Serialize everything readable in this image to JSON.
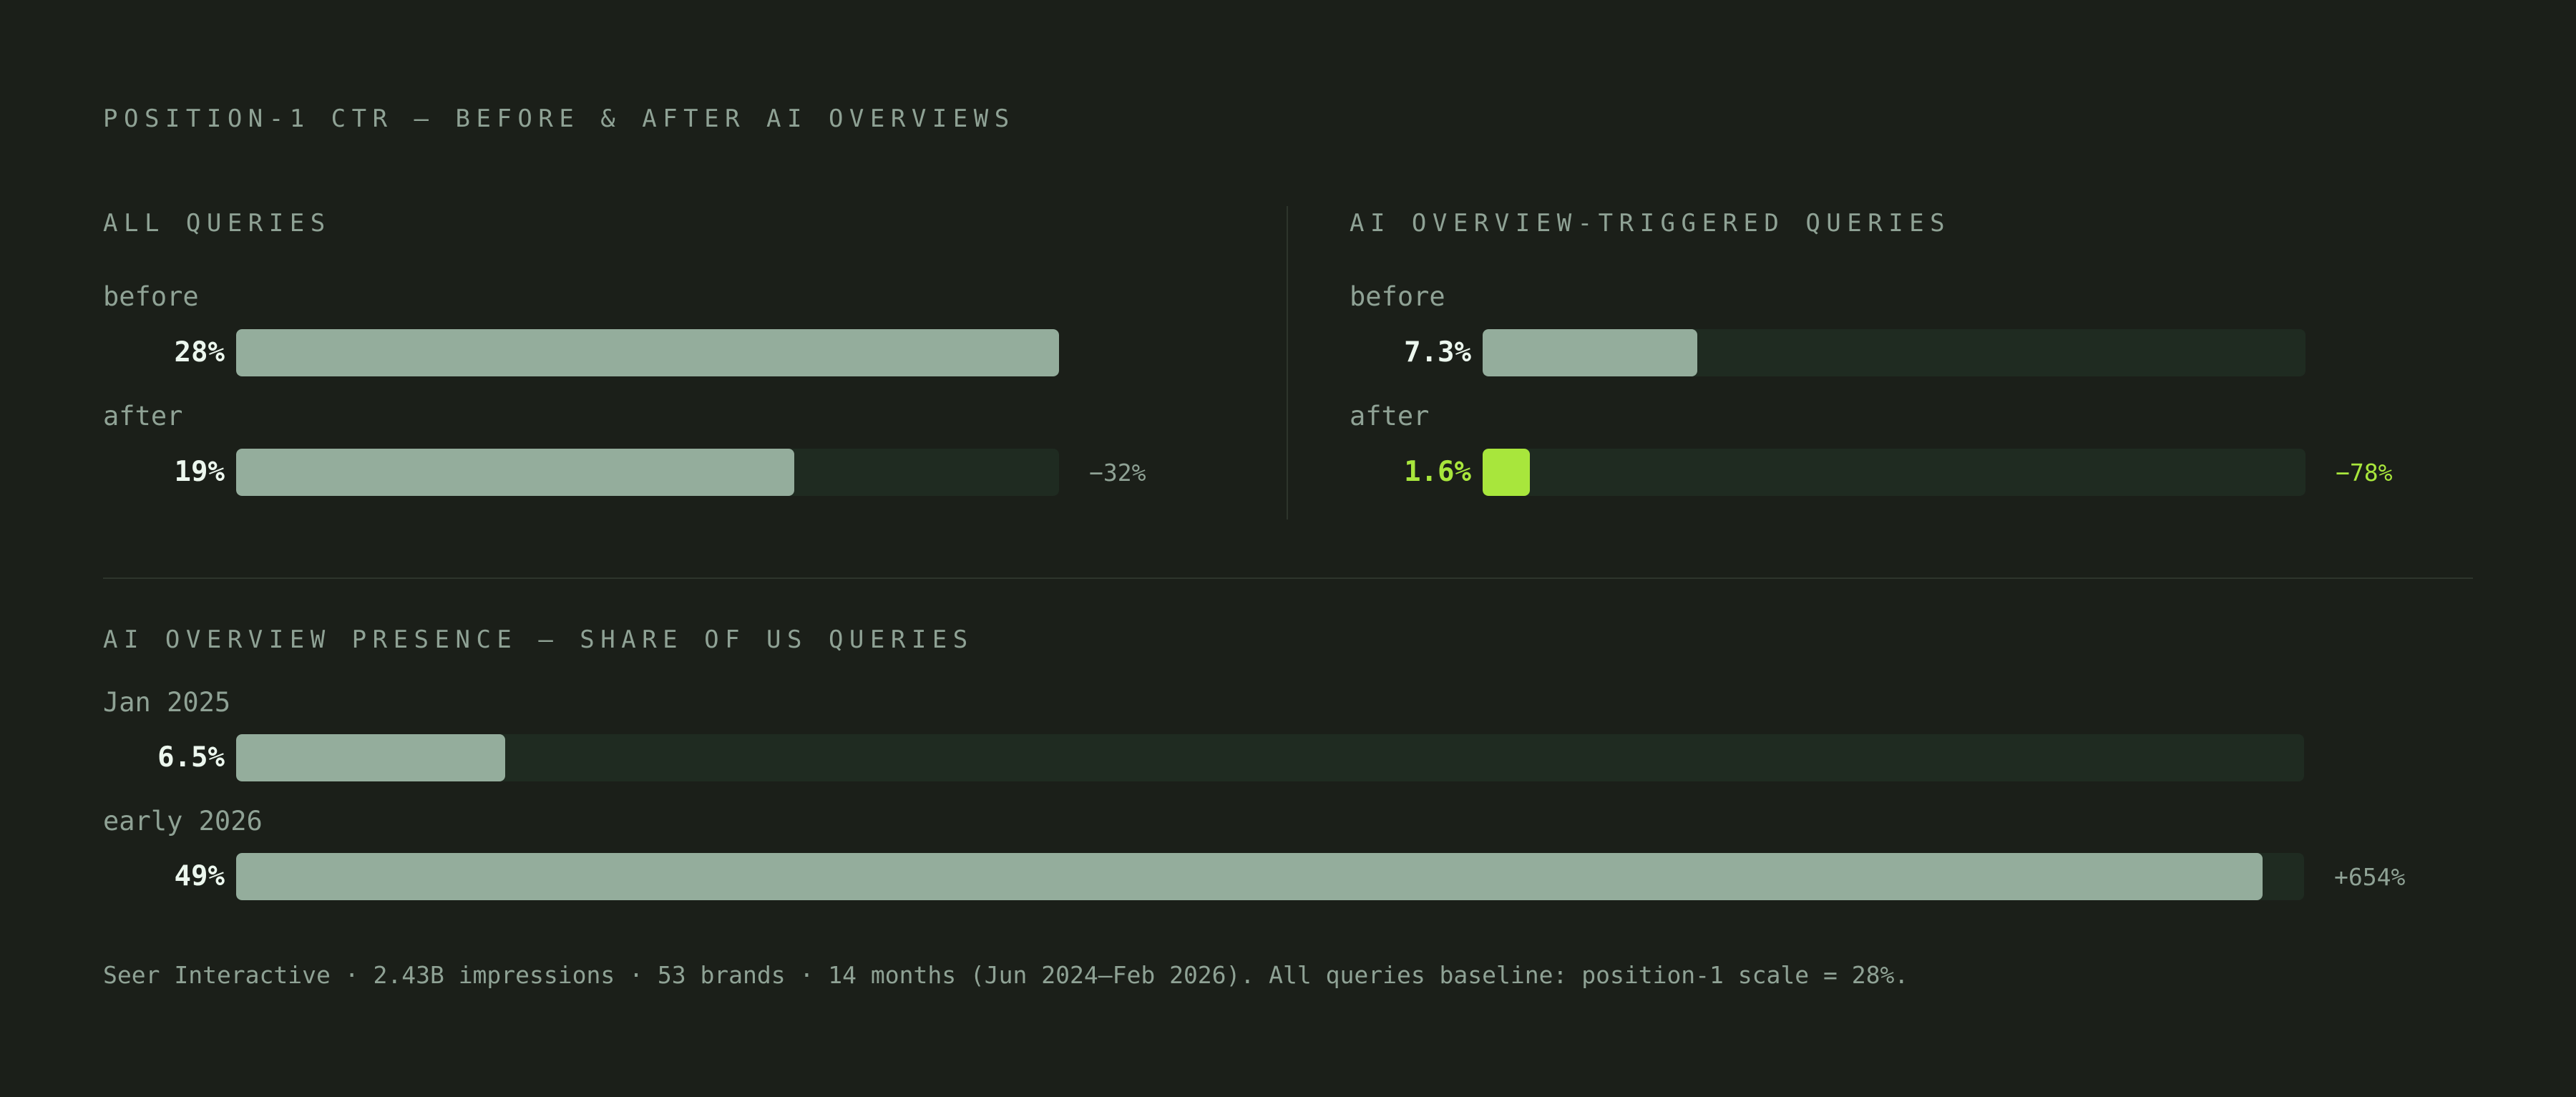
{
  "title": "POSITION-1 CTR — BEFORE & AFTER AI OVERVIEWS",
  "footnote": "Seer Interactive · 2.43B impressions · 53 brands · 14 months (Jun 2024–Feb 2026). All queries baseline: position-1 scale = 28%.",
  "colors": {
    "background": "#1b1f19",
    "track": "#1f2b21",
    "bar": "#94ad9c",
    "highlight": "#a8e63c",
    "muted_text": "#8fa295",
    "value_text": "#ecf7ee"
  },
  "chart_data": [
    {
      "type": "bar",
      "orientation": "horizontal",
      "title": "ALL QUERIES",
      "categories": [
        "before",
        "after"
      ],
      "values": [
        28,
        19
      ],
      "value_labels": [
        "28%",
        "19%"
      ],
      "delta_label": "−32%",
      "scale_max": 28,
      "highlight_index": null
    },
    {
      "type": "bar",
      "orientation": "horizontal",
      "title": "AI OVERVIEW-TRIGGERED QUERIES",
      "categories": [
        "before",
        "after"
      ],
      "values": [
        7.3,
        1.6
      ],
      "value_labels": [
        "7.3%",
        "1.6%"
      ],
      "delta_label": "−78%",
      "scale_max": 28,
      "highlight_index": 1
    },
    {
      "type": "bar",
      "orientation": "horizontal",
      "title": "AI OVERVIEW PRESENCE — SHARE OF US QUERIES",
      "categories": [
        "Jan 2025",
        "early 2026"
      ],
      "values": [
        6.5,
        49
      ],
      "value_labels": [
        "6.5%",
        "49%"
      ],
      "delta_label": "+654%",
      "scale_max": 50,
      "highlight_index": null
    }
  ]
}
